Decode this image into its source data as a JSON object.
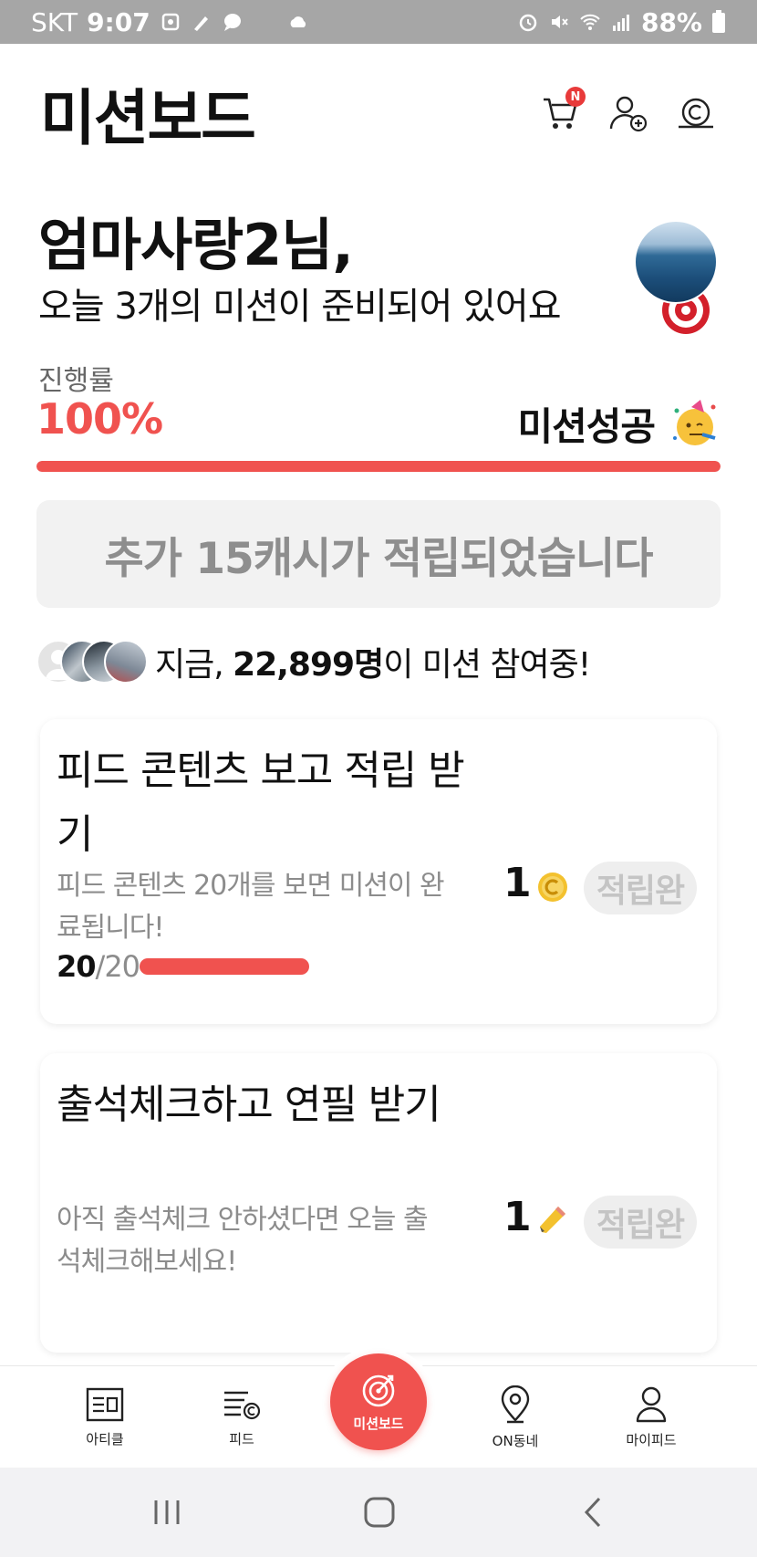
{
  "status_bar": {
    "carrier": "SKT",
    "time": "9:07",
    "battery": "88%",
    "icons": [
      "gallery-icon",
      "pencil-icon",
      "chat-icon",
      "cloud-icon",
      "alarm-icon",
      "mute-icon",
      "wifi-icon",
      "signal-icon",
      "battery-icon"
    ]
  },
  "header": {
    "title": "미션보드",
    "cart_badge": "N",
    "icons": [
      "cart-icon",
      "add-friend-icon",
      "cash-icon"
    ]
  },
  "greeting": {
    "name_line": "엄마사랑2님,",
    "sub_line": "오늘 3개의 미션이 준비되어 있어요"
  },
  "progress": {
    "label": "진행률",
    "value_text": "100%",
    "fraction": 1.0,
    "status_text": "미션성공",
    "accent_color": "#f0524f"
  },
  "cash_notice": "추가 15캐시가 적립되었습니다",
  "participants": {
    "prefix": "지금, ",
    "count": "22,899명",
    "suffix": "이 미션 참여중!"
  },
  "missions": [
    {
      "title": "피드 콘텐츠 보고 적립 받기",
      "description": "피드 콘텐츠 20개를 보면 미션이 완료됩니다!",
      "reward": "1",
      "reward_icon": "coin-icon",
      "status": "적립완",
      "progress_done": "20",
      "progress_total": "/20",
      "progress_fraction": 1.0
    },
    {
      "title": "출석체크하고 연필 받기",
      "description": "아직 출석체크 안하셨다면 오늘 출석체크해보세요!",
      "reward": "1",
      "reward_icon": "pencil-icon",
      "status": "적립완"
    }
  ],
  "bottom_nav": {
    "items": [
      {
        "label": "아티클",
        "icon": "article-icon"
      },
      {
        "label": "피드",
        "icon": "feed-icon"
      },
      {
        "label": "미션보드",
        "icon": "target-icon"
      },
      {
        "label": "ON동네",
        "icon": "location-icon"
      },
      {
        "label": "마이피드",
        "icon": "profile-icon"
      }
    ]
  },
  "system_nav": {
    "icons": [
      "recent-apps-icon",
      "home-icon",
      "back-icon"
    ]
  }
}
